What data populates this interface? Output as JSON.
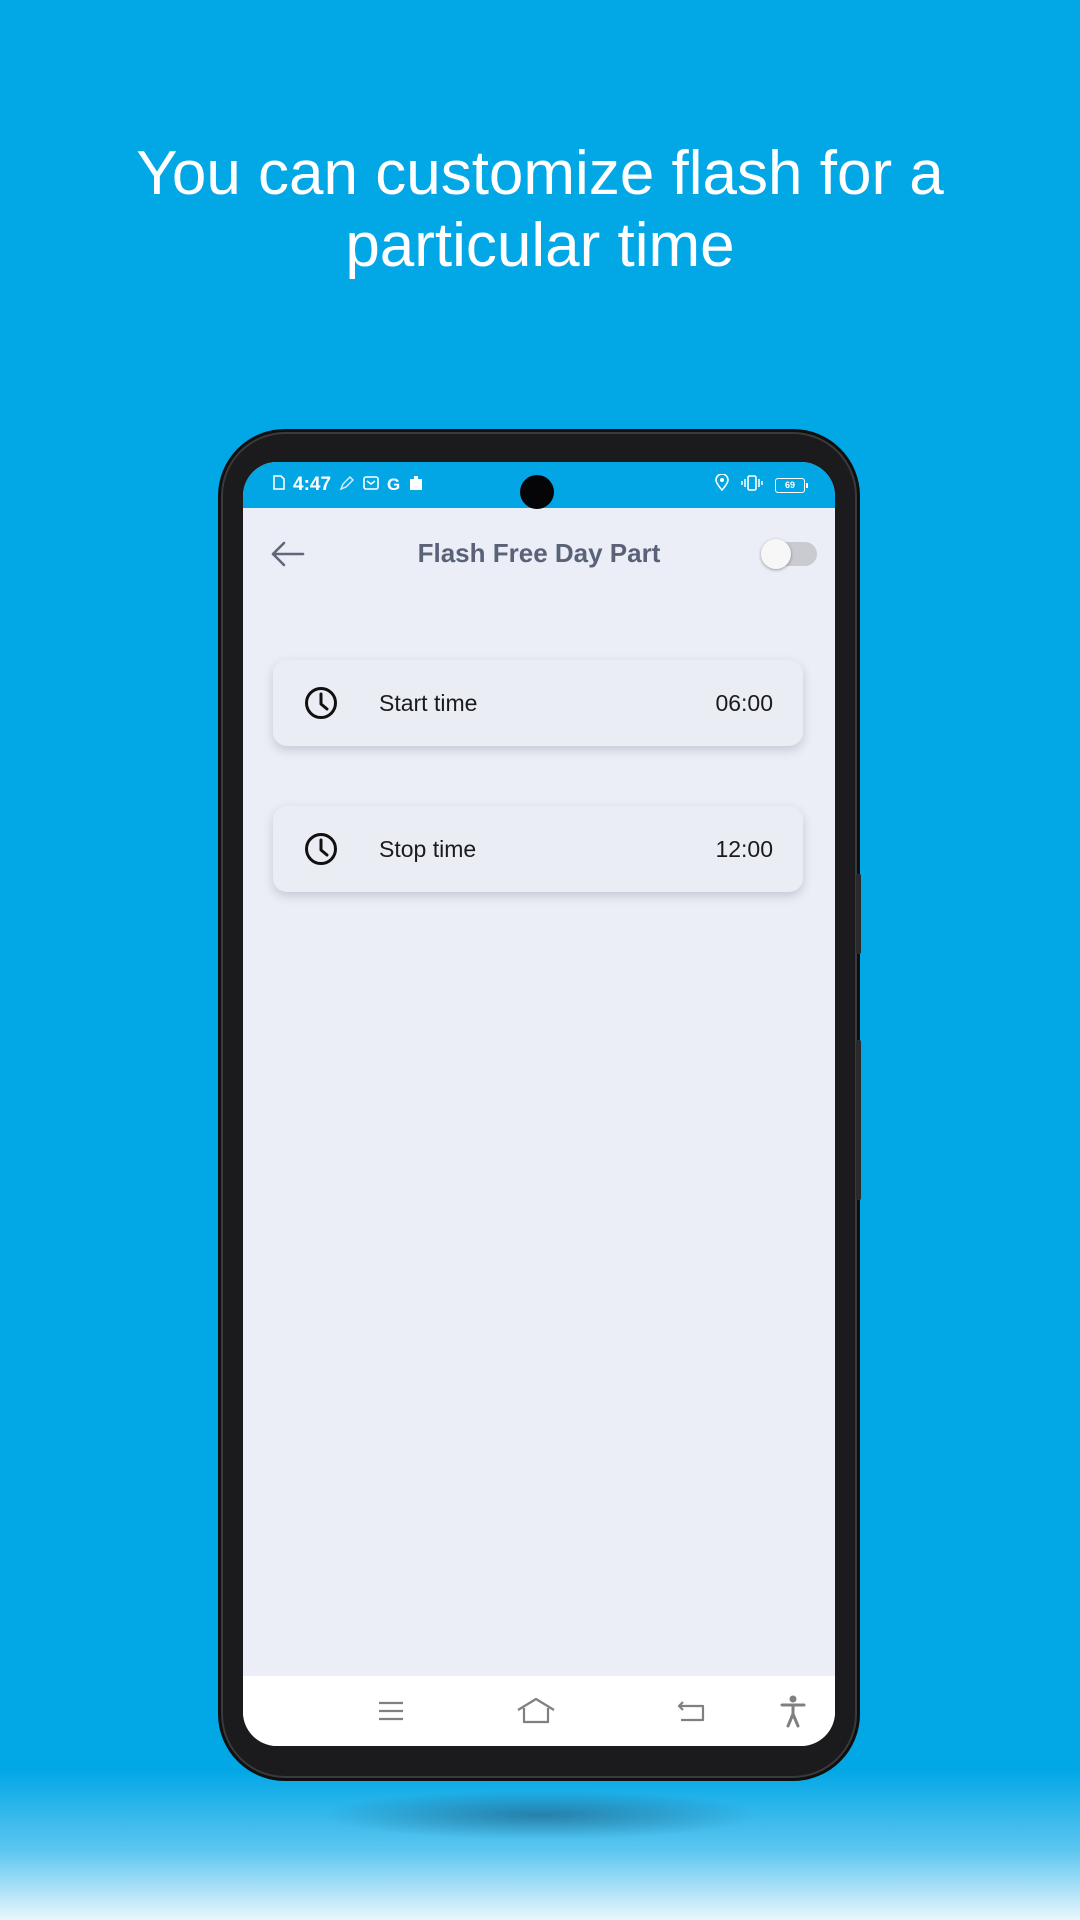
{
  "headline": "You can customize flash for a particular time",
  "colors": {
    "background": "#02a7e6",
    "status_bar": "#03a6e5",
    "screen": "#ebeef6",
    "title": "#5a6278"
  },
  "status_bar": {
    "time": "4:47",
    "battery": "69",
    "left_icons": [
      "sim-card-icon",
      "pen-icon",
      "mail-icon",
      "google-icon",
      "puzzle-icon"
    ],
    "right_icons": [
      "location-icon",
      "vibrate-icon",
      "battery-icon"
    ]
  },
  "app_bar": {
    "title": "Flash Free Day Part",
    "toggle_on": false
  },
  "time_settings": [
    {
      "label": "Start time",
      "value": "06:00",
      "icon": "clock-icon"
    },
    {
      "label": "Stop time",
      "value": "12:00",
      "icon": "clock-icon"
    }
  ],
  "nav_bar": {
    "buttons": [
      "menu-icon",
      "home-icon",
      "back-icon",
      "accessibility-icon"
    ]
  }
}
